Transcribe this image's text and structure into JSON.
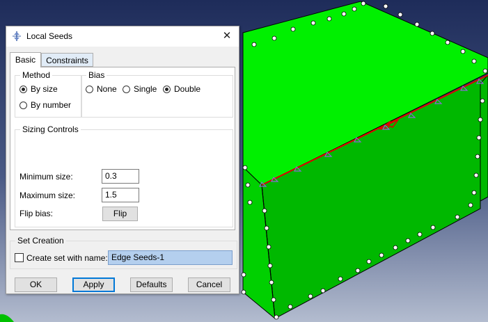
{
  "dialog": {
    "title": "Local Seeds",
    "tabs": [
      {
        "label": "Basic",
        "active": true
      },
      {
        "label": "Constraints",
        "active": false
      }
    ],
    "method": {
      "legend": "Method",
      "options": [
        {
          "label": "By size",
          "selected": true
        },
        {
          "label": "By number",
          "selected": false
        }
      ]
    },
    "bias": {
      "legend": "Bias",
      "options": [
        {
          "label": "None",
          "selected": false
        },
        {
          "label": "Single",
          "selected": false
        },
        {
          "label": "Double",
          "selected": true
        }
      ]
    },
    "sizing": {
      "legend": "Sizing Controls",
      "min_label": "Minimum size:",
      "min_value": "0.3",
      "max_label": "Maximum size:",
      "max_value": "1.5",
      "flip_label": "Flip bias:",
      "flip_button": "Flip"
    },
    "set_creation": {
      "legend": "Set Creation",
      "checkbox_label": "Create set with name:",
      "checked": false,
      "name_value": "Edge Seeds-1"
    },
    "buttons": {
      "ok": "OK",
      "apply": "Apply",
      "defaults": "Defaults",
      "cancel": "Cancel"
    }
  },
  "colors": {
    "background_top": "#1e2c5a",
    "background_bottom": "#b3bccf",
    "box_top": "#00f000",
    "box_front": "#00c800",
    "box_side": "#00a000",
    "seed_edge": "#e00000",
    "seed_marker": "#8a6bd1"
  }
}
